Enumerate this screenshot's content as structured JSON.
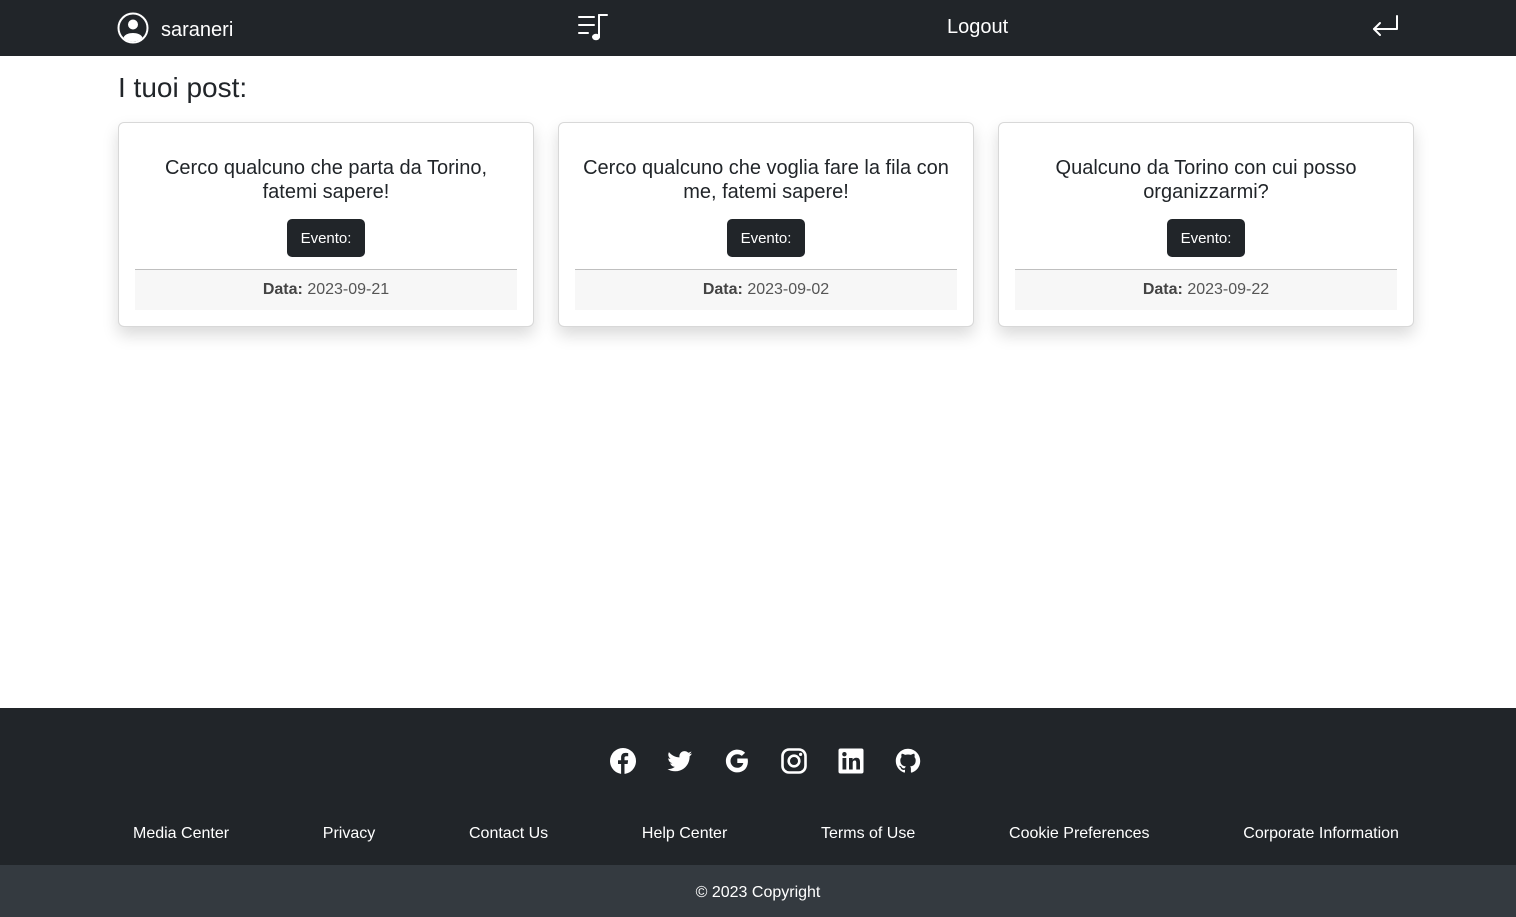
{
  "navbar": {
    "username": "saraneri",
    "logout_label": "Logout",
    "icons": [
      "user-circle-icon",
      "music-playlist-icon",
      "return-arrow-icon"
    ]
  },
  "main": {
    "title": "I tuoi post:",
    "posts": [
      {
        "title": "Cerco qualcuno che parta da Torino, fatemi sapere!",
        "event_label": "Evento:",
        "date_label": "Data:",
        "date": "2023-09-21"
      },
      {
        "title": "Cerco qualcuno che voglia fare la fila con me, fatemi sapere!",
        "event_label": "Evento:",
        "date_label": "Data:",
        "date": "2023-09-02"
      },
      {
        "title": "Qualcuno da Torino con cui posso organizzarmi?",
        "event_label": "Evento:",
        "date_label": "Data:",
        "date": "2023-09-22"
      }
    ]
  },
  "footer": {
    "social_icons": [
      "facebook-icon",
      "twitter-icon",
      "google-icon",
      "instagram-icon",
      "linkedin-icon",
      "github-icon"
    ],
    "links": [
      "Media Center",
      "Privacy",
      "Contact Us",
      "Help Center",
      "Terms of Use",
      "Cookie Preferences",
      "Corporate Information"
    ],
    "copyright": "© 2023 Copyright"
  },
  "colors": {
    "dark": "#212529",
    "copyright_bg": "#343a40",
    "card_footer_bg": "#f7f7f7"
  }
}
